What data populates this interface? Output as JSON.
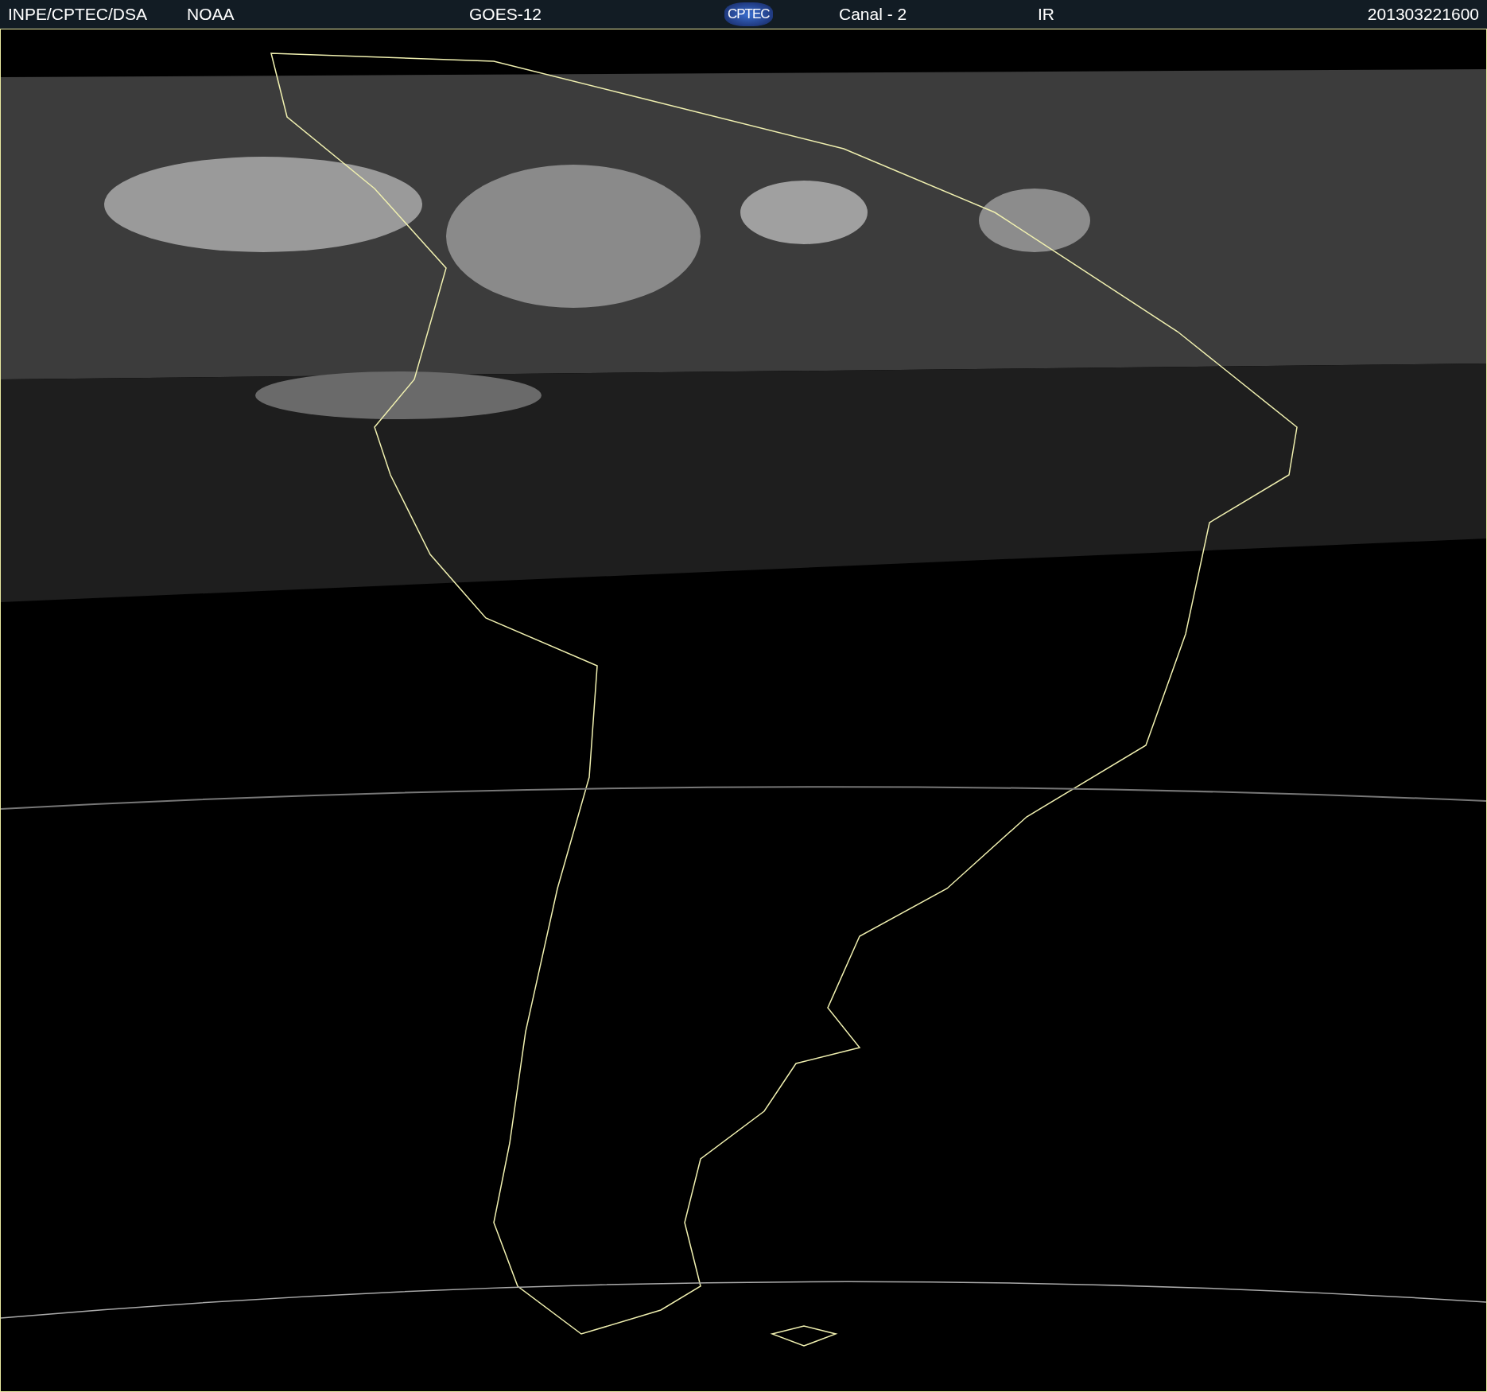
{
  "header": {
    "labels": [
      {
        "kind": "text",
        "text": "INPE/CPTEC/DSA"
      },
      {
        "kind": "text",
        "text": "NOAA"
      },
      {
        "kind": "text",
        "text": "GOES-12"
      },
      {
        "kind": "logo",
        "text": "CPTEC"
      },
      {
        "kind": "text",
        "text": "Canal - 2"
      },
      {
        "kind": "text",
        "text": "IR"
      },
      {
        "kind": "text",
        "text": "201303221600"
      }
    ]
  }
}
